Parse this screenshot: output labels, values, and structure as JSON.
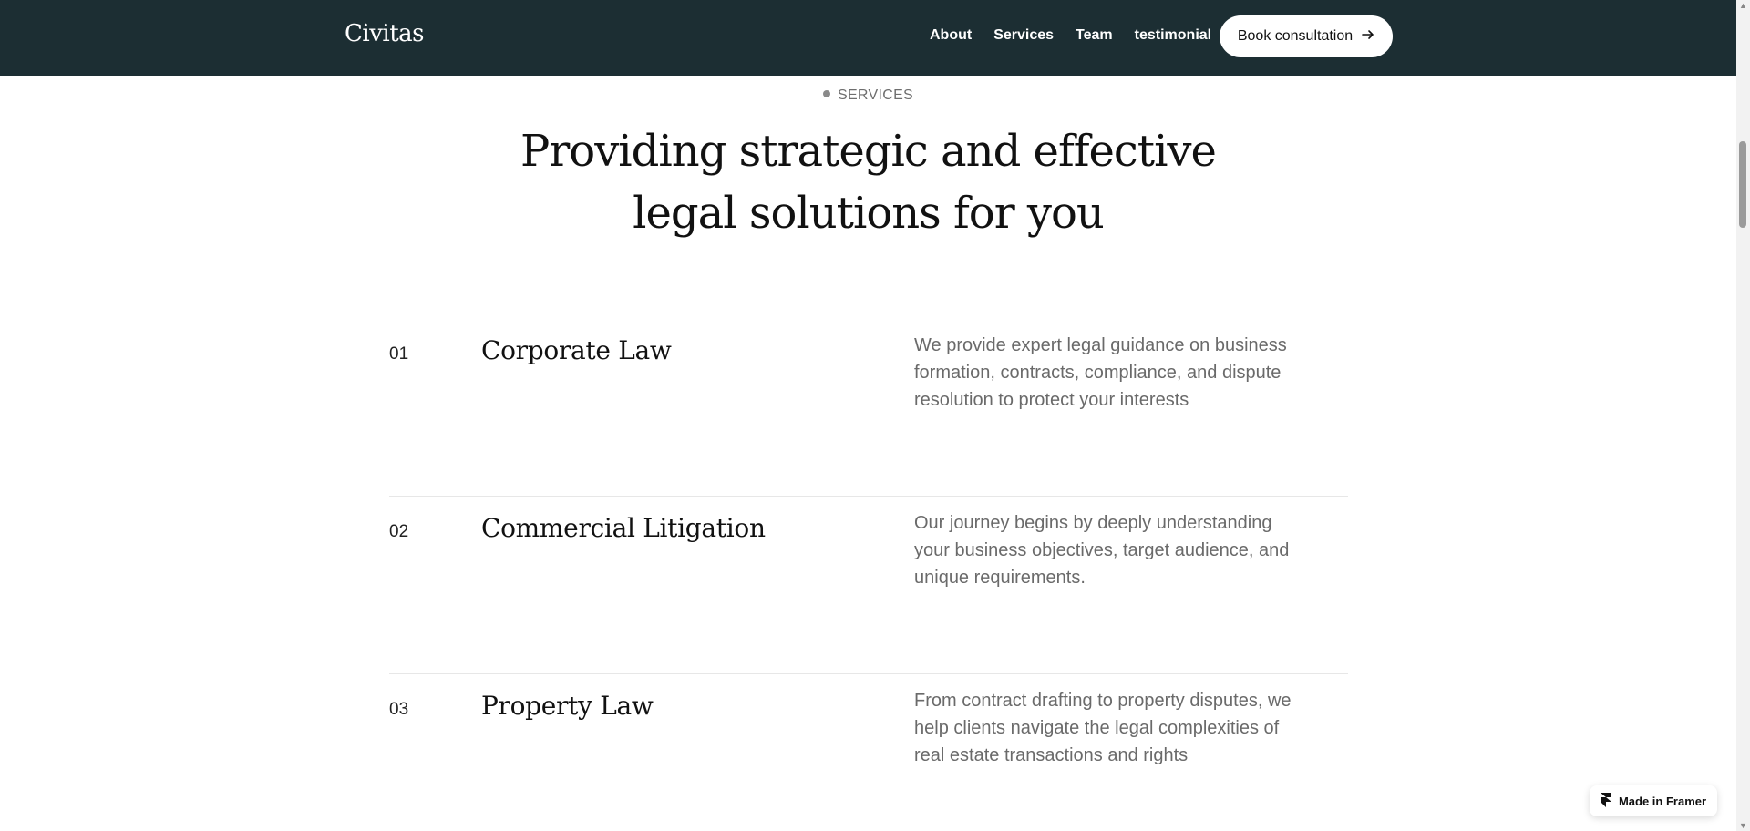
{
  "nav": {
    "brand": "Civitas",
    "links": [
      "About",
      "Services",
      "Team",
      "testimonial"
    ],
    "cta_label": "Book consultation",
    "cta_icon": "arrow-right-icon"
  },
  "section": {
    "eyebrow": "SERVICES",
    "headline_line1": "Providing strategic and effective",
    "headline_line2": "legal solutions for you"
  },
  "services": [
    {
      "number": "01",
      "title": "Corporate Law",
      "description": "We provide expert legal guidance on business formation, contracts, compliance, and dispute resolution to protect your interests"
    },
    {
      "number": "02",
      "title": "Commercial Litigation",
      "description": "Our journey begins by deeply understanding your business objectives, target audience, and unique requirements."
    },
    {
      "number": "03",
      "title": "Property Law",
      "description": "From contract drafting to property disputes, we help clients navigate the legal complexities of real estate transactions and rights"
    }
  ],
  "badge": {
    "label": "Made in Framer",
    "icon": "framer-logo-icon"
  },
  "colors": {
    "nav_bg": "#1c2e33",
    "text_muted": "#6a6a6a"
  }
}
